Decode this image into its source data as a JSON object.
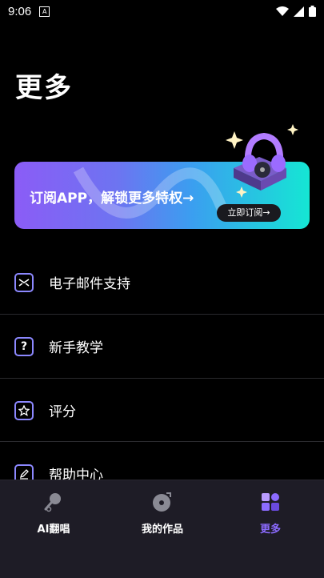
{
  "status": {
    "time": "9:06",
    "a_badge": "A"
  },
  "page": {
    "title": "更多"
  },
  "banner": {
    "text": "订阅APP，解锁更多特权→",
    "button": "立即订阅→"
  },
  "menu": [
    {
      "label": "电子邮件支持",
      "icon": "mail-icon"
    },
    {
      "label": "新手教学",
      "icon": "question-icon"
    },
    {
      "label": "评分",
      "icon": "star-icon"
    },
    {
      "label": "帮助中心",
      "icon": "edit-icon"
    }
  ],
  "tabs": [
    {
      "label": "AI翻唱",
      "icon": "microphone-icon",
      "active": false
    },
    {
      "label": "我的作品",
      "icon": "music-disc-icon",
      "active": false
    },
    {
      "label": "更多",
      "icon": "grid-more-icon",
      "active": true
    }
  ],
  "colors": {
    "accent": "#8c6bff",
    "icon_border": "#8c88ff",
    "tabbar_bg": "#1e1c26"
  }
}
